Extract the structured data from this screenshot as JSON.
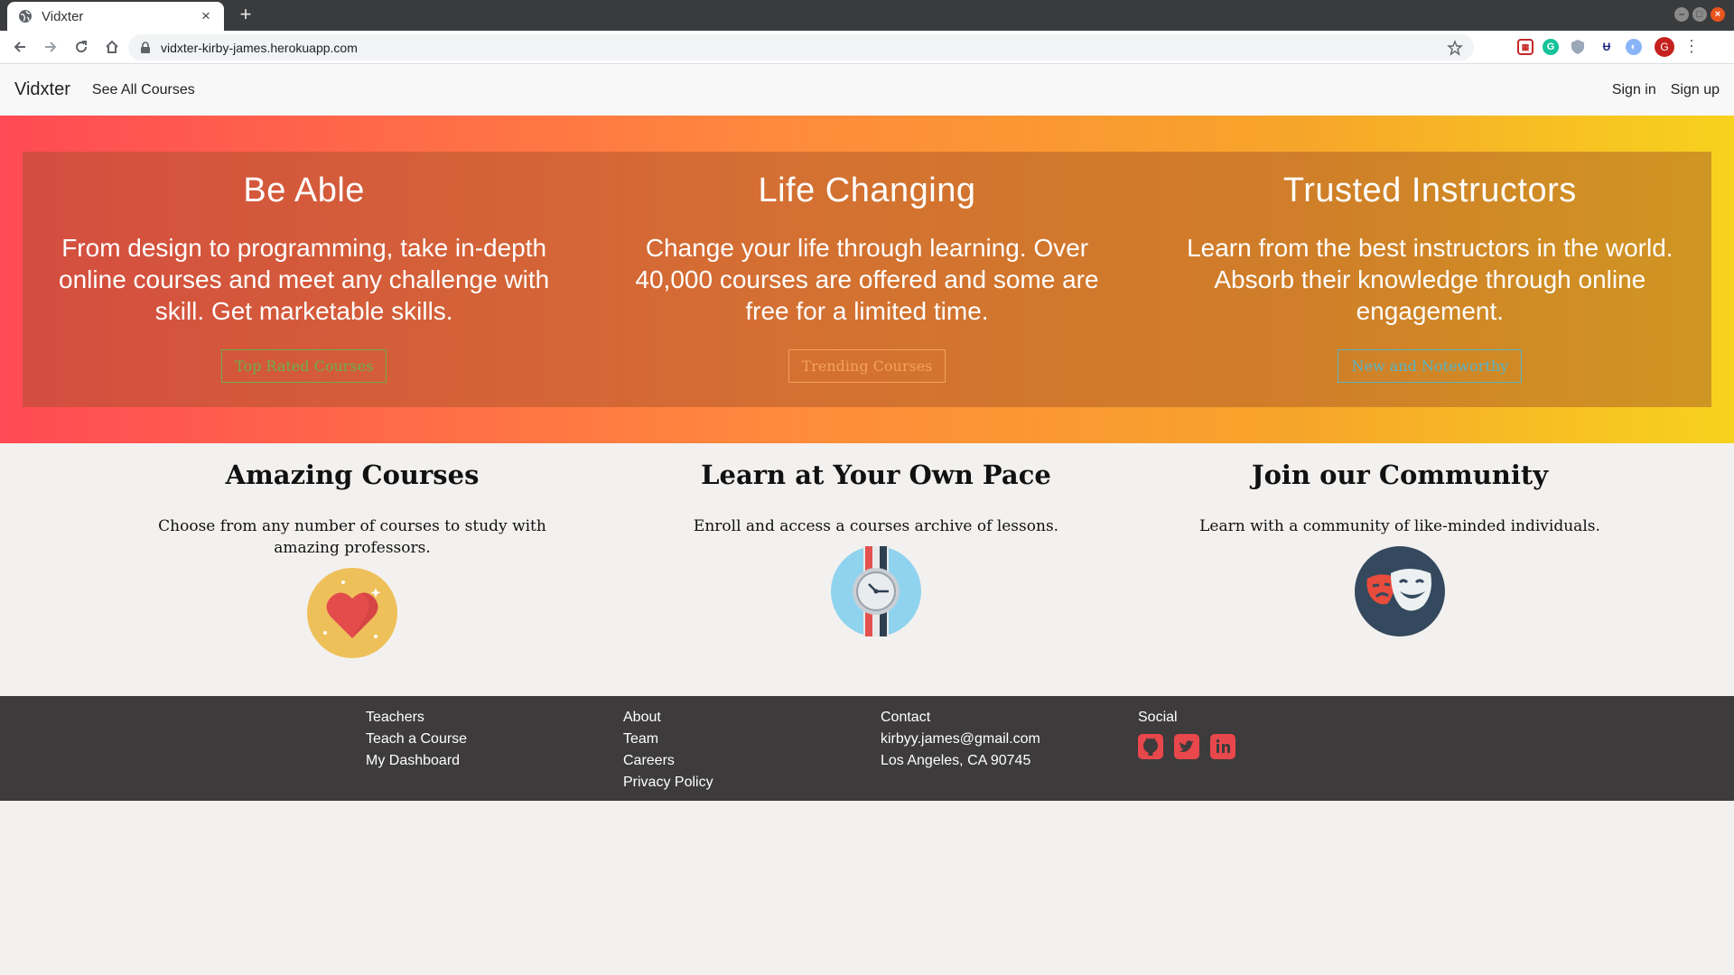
{
  "browser": {
    "tab_title": "Vidxter",
    "url": "vidxter-kirby-james.herokuapp.com",
    "profile_initial": "G"
  },
  "nav": {
    "brand": "Vidxter",
    "see_all": "See All Courses",
    "sign_in": "Sign in",
    "sign_up": "Sign up"
  },
  "hero": {
    "columns": [
      {
        "title": "Be Able",
        "text": "From design to programming, take in-depth online courses and meet any challenge with skill. Get marketable skills.",
        "button": "Top Rated Courses",
        "button_color": "#6bb04a"
      },
      {
        "title": "Life Changing",
        "text": "Change your life through learning. Over 40,000 courses are offered and some are free for a limited time.",
        "button": "Trending Courses",
        "button_color": "#f5a25a"
      },
      {
        "title": "Trusted Instructors",
        "text": "Learn from the best instructors in the world. Absorb their knowledge through online engagement.",
        "button": "New and Noteworthy",
        "button_color": "#58b4c8"
      }
    ]
  },
  "features": [
    {
      "title": "Amazing Courses",
      "text": "Choose from any number of courses to study with amazing professors.",
      "icon": "heart-icon"
    },
    {
      "title": "Learn at Your Own Pace",
      "text": "Enroll and access a courses archive of lessons.",
      "icon": "watch-icon"
    },
    {
      "title": "Join our Community",
      "text": "Learn with a community of like-minded individuals.",
      "icon": "theater-masks-icon"
    }
  ],
  "footer": {
    "teachers": {
      "heading": "Teachers",
      "items": [
        "Teach a Course",
        "My Dashboard"
      ]
    },
    "about": {
      "heading": "About",
      "items": [
        "Team",
        "Careers",
        "Privacy Policy"
      ]
    },
    "contact": {
      "heading": "Contact",
      "items": [
        "kirbyy.james@gmail.com",
        "Los Angeles, CA 90745"
      ]
    },
    "social": {
      "heading": "Social",
      "icons": [
        "github-icon",
        "twitter-icon",
        "linkedin-icon"
      ],
      "icon_color": "#e8474b"
    }
  }
}
